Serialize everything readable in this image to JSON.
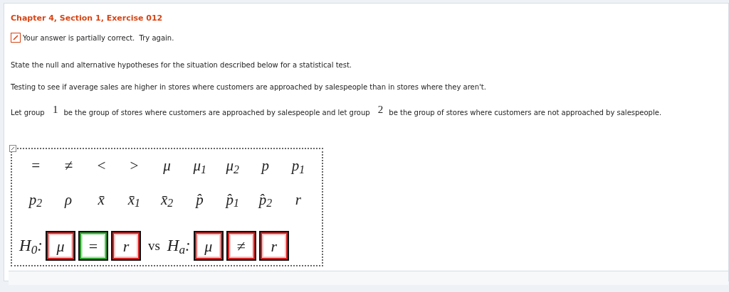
{
  "title": "Chapter 4, Section 1, Exercise 012",
  "feedback": {
    "text": "Your answer is partially correct.  Try again.",
    "correct": false
  },
  "instructions": "State the null and alternative hypotheses for the situation described below for a statistical test.",
  "scenario": "Testing to see if average sales are higher in stores where customers are approached by salespeople than in stores where they aren't.",
  "group_sentence": [
    {
      "kind": "text",
      "text": "Let group"
    },
    {
      "kind": "value",
      "text": "1"
    },
    {
      "kind": "text",
      "text": "be the group of stores where customers are approached by salespeople and let group"
    },
    {
      "kind": "value",
      "text": "2"
    },
    {
      "kind": "text",
      "text": "be the group of stores where customers are not approached by salespeople."
    }
  ],
  "palette": [
    [
      "=",
      "≠",
      "<",
      ">",
      "μ",
      "μ$_{1}$",
      "μ$_{2}$",
      "p",
      "p$_{1}$"
    ],
    [
      "p$_{2}$",
      "ρ",
      "x̄",
      "x̄$_{1}$",
      "x̄$_{2}$",
      "p̂",
      "p̂$_{1}$",
      "p̂$_{2}$",
      "r"
    ]
  ],
  "null_label": "H$_{0}$:",
  "separator": "vs",
  "alt_label": "H$_{a}$:",
  "null_boxes": [
    {
      "symbol": "μ",
      "correct": false
    },
    {
      "symbol": "=",
      "correct": true
    },
    {
      "symbol": "r",
      "correct": false
    }
  ],
  "alt_boxes": [
    {
      "symbol": "μ",
      "correct": false
    },
    {
      "symbol": "≠",
      "correct": false
    },
    {
      "symbol": "r",
      "correct": false
    }
  ]
}
